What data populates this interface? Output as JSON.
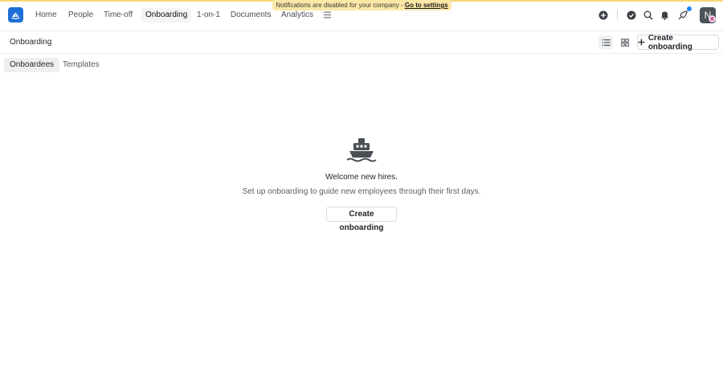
{
  "banner": {
    "text": "Notifications are disabled for your company - ",
    "link": "Go to settings"
  },
  "nav": {
    "items": [
      {
        "label": "Home"
      },
      {
        "label": "People"
      },
      {
        "label": "Time-off"
      },
      {
        "label": "Onboarding"
      },
      {
        "label": "1-on-1"
      },
      {
        "label": "Documents"
      },
      {
        "label": "Analytics"
      }
    ],
    "active": "Onboarding",
    "avatar_initial": "N"
  },
  "page": {
    "title": "Onboarding",
    "create_label": "Create onboarding"
  },
  "tabs": [
    {
      "label": "Onboardees",
      "active": true
    },
    {
      "label": "Templates",
      "active": false
    }
  ],
  "empty_state": {
    "icon": "ship-icon",
    "title": "Welcome new hires.",
    "subtitle": "Set up onboarding to guide new employees through their first days.",
    "button_label": "Create onboarding"
  },
  "colors": {
    "brand": "#1f6fd6",
    "banner": "#fbe7a6",
    "notification_dot": "#1e88ff"
  }
}
